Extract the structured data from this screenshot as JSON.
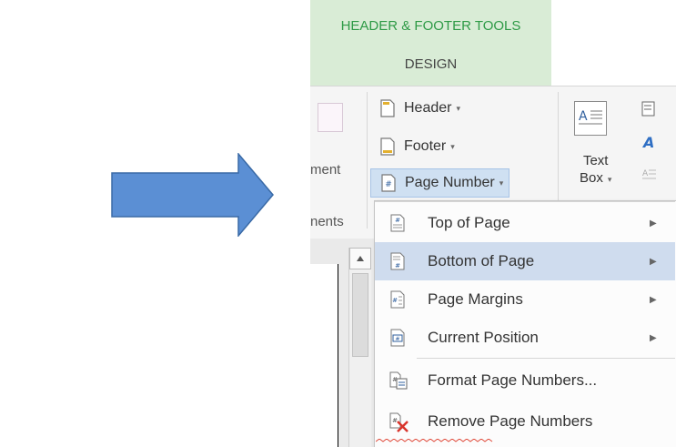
{
  "ribbon": {
    "contextual_tab_group": "HEADER & FOOTER TOOLS",
    "design_tab": "DESIGN",
    "partial_group_label_1": "ment",
    "partial_group_label_2": "nents",
    "header_button": "Header",
    "footer_button": "Footer",
    "page_number_button": "Page Number",
    "text_box_line1": "Text",
    "text_box_line2": "Box",
    "dropdown_caret": "▾"
  },
  "menu": {
    "items": [
      {
        "label": "Top of Page",
        "has_submenu": true
      },
      {
        "label": "Bottom of Page",
        "has_submenu": true,
        "highlighted": true
      },
      {
        "label": "Page Margins",
        "has_submenu": true
      },
      {
        "label": "Current Position",
        "has_submenu": true
      },
      {
        "label": "Format Page Numbers...",
        "has_submenu": false
      },
      {
        "label": "Remove Page Numbers",
        "has_submenu": false
      }
    ],
    "submenu_arrow": "▶"
  },
  "colors": {
    "arrow_fill": "#5b8fd4",
    "arrow_stroke": "#3a6aa6",
    "contextual_tab_bg": "#d9ecd6",
    "contextual_tab_text": "#2e9a46",
    "highlight_bg": "#cfdcee"
  },
  "icons": {
    "pointer_arrow": "right-arrow-shape",
    "header": "header-page-icon",
    "footer": "footer-page-icon",
    "page_number": "page-number-icon",
    "text_box": "text-box-icon",
    "remove": "remove-page-numbers-icon"
  }
}
